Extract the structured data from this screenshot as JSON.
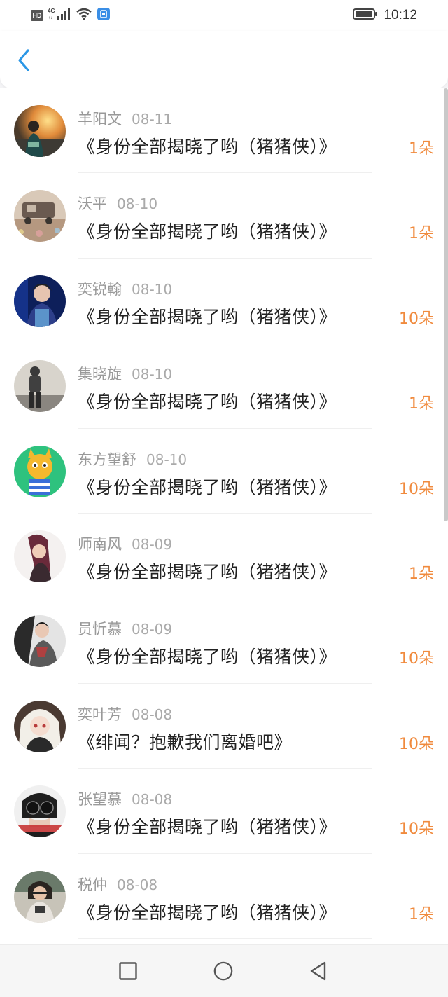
{
  "status_bar": {
    "network_badge": "HD",
    "network_type": "4G",
    "time": "10:12",
    "icons": [
      "signal-icon",
      "wifi-icon",
      "sim-app-icon",
      "battery-icon"
    ]
  },
  "header": {
    "back_icon": "chevron-left-icon",
    "accent_color": "#2b97e6"
  },
  "theme": {
    "amount_color": "#f08a3d",
    "name_color": "#999999",
    "title_color": "#222222"
  },
  "rows": [
    {
      "name": "羊阳文",
      "date": "08-11",
      "title": "《身份全部揭晓了哟（猪猪侠）》",
      "amount": "1朵"
    },
    {
      "name": "沃平",
      "date": "08-10",
      "title": "《身份全部揭晓了哟（猪猪侠）》",
      "amount": "1朵"
    },
    {
      "name": "奕锐翰",
      "date": "08-10",
      "title": "《身份全部揭晓了哟（猪猪侠）》",
      "amount": "10朵"
    },
    {
      "name": "集晓旋",
      "date": "08-10",
      "title": "《身份全部揭晓了哟（猪猪侠）》",
      "amount": "1朵"
    },
    {
      "name": "东方望舒",
      "date": "08-10",
      "title": "《身份全部揭晓了哟（猪猪侠）》",
      "amount": "10朵"
    },
    {
      "name": "师南风",
      "date": "08-09",
      "title": "《身份全部揭晓了哟（猪猪侠）》",
      "amount": "1朵"
    },
    {
      "name": "员忻慕",
      "date": "08-09",
      "title": "《身份全部揭晓了哟（猪猪侠）》",
      "amount": "10朵"
    },
    {
      "name": "奕叶芳",
      "date": "08-08",
      "title": "《绯闻？抱歉我们离婚吧》",
      "amount": "10朵"
    },
    {
      "name": "张望慕",
      "date": "08-08",
      "title": "《身份全部揭晓了哟（猪猪侠）》",
      "amount": "10朵"
    },
    {
      "name": "税仲",
      "date": "08-08",
      "title": "《身份全部揭晓了哟（猪猪侠）》",
      "amount": "1朵"
    }
  ],
  "nav_bar": {
    "recent_icon": "square-icon",
    "home_icon": "circle-icon",
    "back_icon": "triangle-back-icon"
  }
}
